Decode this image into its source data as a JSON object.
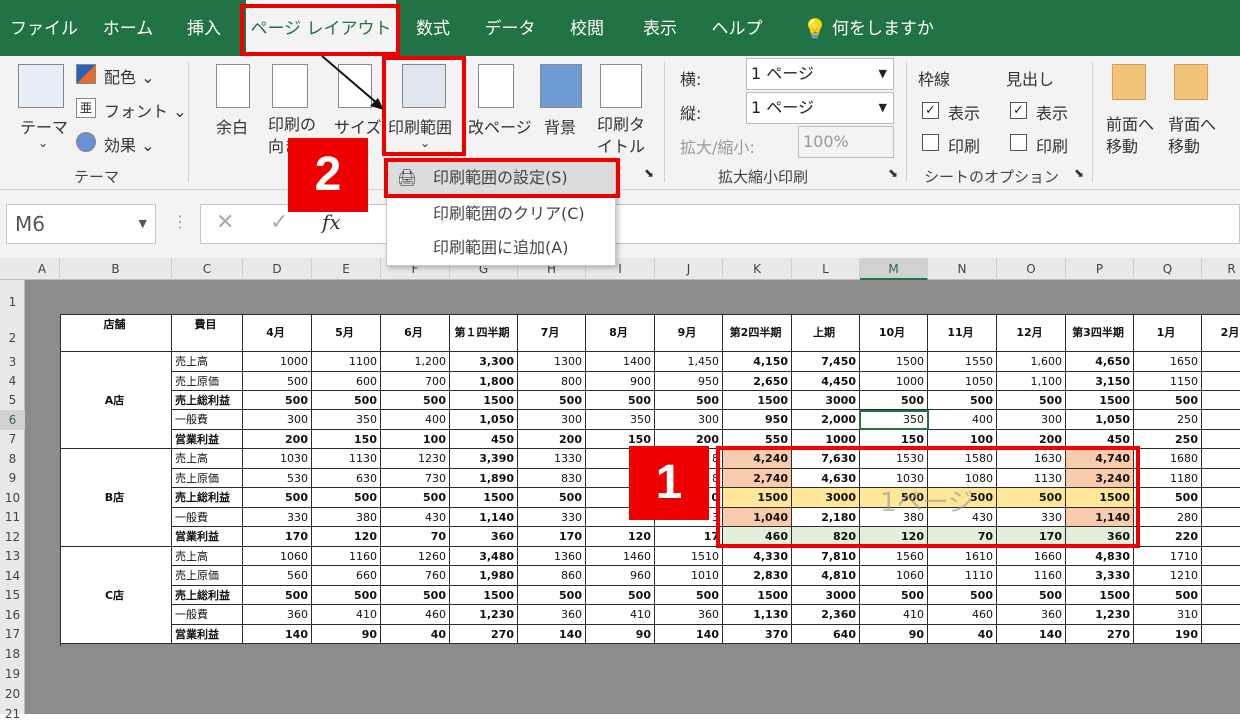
{
  "tabs": [
    {
      "label": "ファイル"
    },
    {
      "label": "ホーム"
    },
    {
      "label": "挿入"
    },
    {
      "label": "ページ レイアウト"
    },
    {
      "label": "数式"
    },
    {
      "label": "データ"
    },
    {
      "label": "校閲"
    },
    {
      "label": "表示"
    },
    {
      "label": "ヘルプ"
    },
    {
      "label": "何をしますか"
    }
  ],
  "ribbon": {
    "theme_label": "テーマ",
    "colors_label": "配色",
    "fonts_label": "フォント",
    "effects_label": "効果",
    "group_theme": "テーマ",
    "margins_label": "余白",
    "orientation_label": "印刷の向き",
    "size_label": "サイズ",
    "print_area_label": "印刷範囲",
    "breaks_label": "改ページ",
    "background_label": "背景",
    "print_titles_label": "印刷タイトル",
    "width_label": "横:",
    "width_value": "1 ページ",
    "height_label": "縦:",
    "height_value": "1 ページ",
    "scale_label": "拡大/縮小:",
    "scale_value": "100%",
    "group_scale": "拡大縮小印刷",
    "gridlines_label": "枠線",
    "headings_label": "見出し",
    "view_label": "表示",
    "print_label": "印刷",
    "group_sheet": "シートのオプション",
    "bring_forward_label": "前面へ移動",
    "send_backward_label": "背面へ移動"
  },
  "menu": {
    "set": "印刷範囲の設定(S)",
    "clear": "印刷範囲のクリア(C)",
    "add": "印刷範囲に追加(A)"
  },
  "namebox": "M6",
  "fx": "fx",
  "badges": {
    "one": "1",
    "two": "2"
  },
  "page_watermark": "1ページ",
  "columns": [
    "A",
    "B",
    "C",
    "D",
    "E",
    "F",
    "G",
    "H",
    "I",
    "J",
    "K",
    "L",
    "M",
    "N",
    "O",
    "P",
    "Q",
    "R"
  ],
  "rows": [
    "1",
    "2",
    "3",
    "4",
    "5",
    "6",
    "7",
    "8",
    "9",
    "10",
    "11",
    "12",
    "13",
    "14",
    "15",
    "16",
    "17",
    "18",
    "19",
    "20",
    "21"
  ],
  "table": {
    "h_store": "店舗",
    "h_item": "費目",
    "headers": [
      "4月",
      "5月",
      "6月",
      "第１四半期",
      "7月",
      "8月",
      "9月",
      "第2四半期",
      "上期",
      "10月",
      "11月",
      "12月",
      "第3四半期",
      "1月",
      "2月"
    ],
    "stores": [
      "A店",
      "B店",
      "C店"
    ],
    "items": [
      "売上高",
      "売上原価",
      "売上総利益",
      "一般費",
      "営業利益"
    ],
    "data": [
      [
        "1000",
        "1100",
        "1,200",
        "3,300",
        "1300",
        "1400",
        "1,450",
        "4,150",
        "7,450",
        "1500",
        "1550",
        "1,600",
        "4,650",
        "1650",
        ""
      ],
      [
        "500",
        "600",
        "700",
        "1,800",
        "800",
        "900",
        "950",
        "2,650",
        "4,450",
        "1000",
        "1050",
        "1,100",
        "3,150",
        "1150",
        ""
      ],
      [
        "500",
        "500",
        "500",
        "1500",
        "500",
        "500",
        "500",
        "1500",
        "3000",
        "500",
        "500",
        "500",
        "1500",
        "500",
        ""
      ],
      [
        "300",
        "350",
        "400",
        "1,050",
        "300",
        "350",
        "300",
        "950",
        "2,000",
        "350",
        "400",
        "300",
        "1,050",
        "250",
        ""
      ],
      [
        "200",
        "150",
        "100",
        "450",
        "200",
        "150",
        "200",
        "550",
        "1000",
        "150",
        "100",
        "200",
        "450",
        "250",
        ""
      ],
      [
        "1030",
        "1130",
        "1230",
        "3,390",
        "1330",
        "",
        "8",
        "4,240",
        "7,630",
        "1530",
        "1580",
        "1630",
        "4,740",
        "1680",
        ""
      ],
      [
        "530",
        "630",
        "730",
        "1,890",
        "830",
        "",
        "8",
        "2,740",
        "4,630",
        "1030",
        "1080",
        "1130",
        "3,240",
        "1180",
        ""
      ],
      [
        "500",
        "500",
        "500",
        "1500",
        "500",
        "",
        "0",
        "1500",
        "3000",
        "500",
        "500",
        "500",
        "1500",
        "500",
        ""
      ],
      [
        "330",
        "380",
        "430",
        "1,140",
        "330",
        "",
        "3",
        "1,040",
        "2,180",
        "380",
        "430",
        "330",
        "1,140",
        "280",
        ""
      ],
      [
        "170",
        "120",
        "70",
        "360",
        "170",
        "120",
        "17",
        "460",
        "820",
        "120",
        "70",
        "170",
        "360",
        "220",
        ""
      ],
      [
        "1060",
        "1160",
        "1260",
        "3,480",
        "1360",
        "1460",
        "1510",
        "4,330",
        "7,810",
        "1560",
        "1610",
        "1660",
        "4,830",
        "1710",
        ""
      ],
      [
        "560",
        "660",
        "760",
        "1,980",
        "860",
        "960",
        "1010",
        "2,830",
        "4,810",
        "1060",
        "1110",
        "1160",
        "3,330",
        "1210",
        ""
      ],
      [
        "500",
        "500",
        "500",
        "1500",
        "500",
        "500",
        "500",
        "1500",
        "3000",
        "500",
        "500",
        "500",
        "1500",
        "500",
        ""
      ],
      [
        "360",
        "410",
        "460",
        "1,230",
        "360",
        "410",
        "360",
        "1,130",
        "2,360",
        "410",
        "460",
        "360",
        "1,230",
        "310",
        ""
      ],
      [
        "140",
        "90",
        "40",
        "270",
        "140",
        "90",
        "140",
        "370",
        "640",
        "90",
        "40",
        "140",
        "270",
        "190",
        ""
      ]
    ]
  }
}
